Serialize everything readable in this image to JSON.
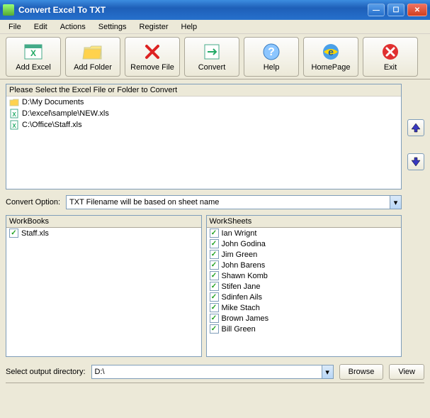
{
  "window": {
    "title": "Convert Excel To TXT"
  },
  "menu": [
    "File",
    "Edit",
    "Actions",
    "Settings",
    "Register",
    "Help"
  ],
  "toolbar": [
    {
      "label": "Add Excel",
      "icon": "excel"
    },
    {
      "label": "Add Folder",
      "icon": "folder"
    },
    {
      "label": "Remove File",
      "icon": "remove"
    },
    {
      "label": "Convert",
      "icon": "convert"
    },
    {
      "label": "Help",
      "icon": "help"
    },
    {
      "label": "HomePage",
      "icon": "ie"
    },
    {
      "label": "Exit",
      "icon": "exit"
    }
  ],
  "file_list": {
    "header": "Please Select the Excel File or Folder to Convert",
    "items": [
      {
        "type": "folder",
        "path": "D:\\My Documents"
      },
      {
        "type": "excel",
        "path": "D:\\excel\\sample\\NEW.xls"
      },
      {
        "type": "excel",
        "path": "C:\\Office\\Staff.xls"
      }
    ]
  },
  "convert_option": {
    "label": "Convert Option:",
    "value": "TXT Filename will be based on sheet name"
  },
  "workbooks": {
    "header": "WorkBooks",
    "items": [
      "Staff.xls"
    ]
  },
  "worksheets": {
    "header": "WorkSheets",
    "items": [
      "Ian Wrignt",
      "John Godina",
      "Jim Green",
      "John Barens",
      "Shawn Komb",
      "Stifen Jane",
      "Sdinfen Ails",
      "Mike Stach",
      "Brown James",
      "Bill Green"
    ]
  },
  "output": {
    "label": "Select  output directory:",
    "value": "D:\\",
    "browse": "Browse",
    "view": "View"
  }
}
